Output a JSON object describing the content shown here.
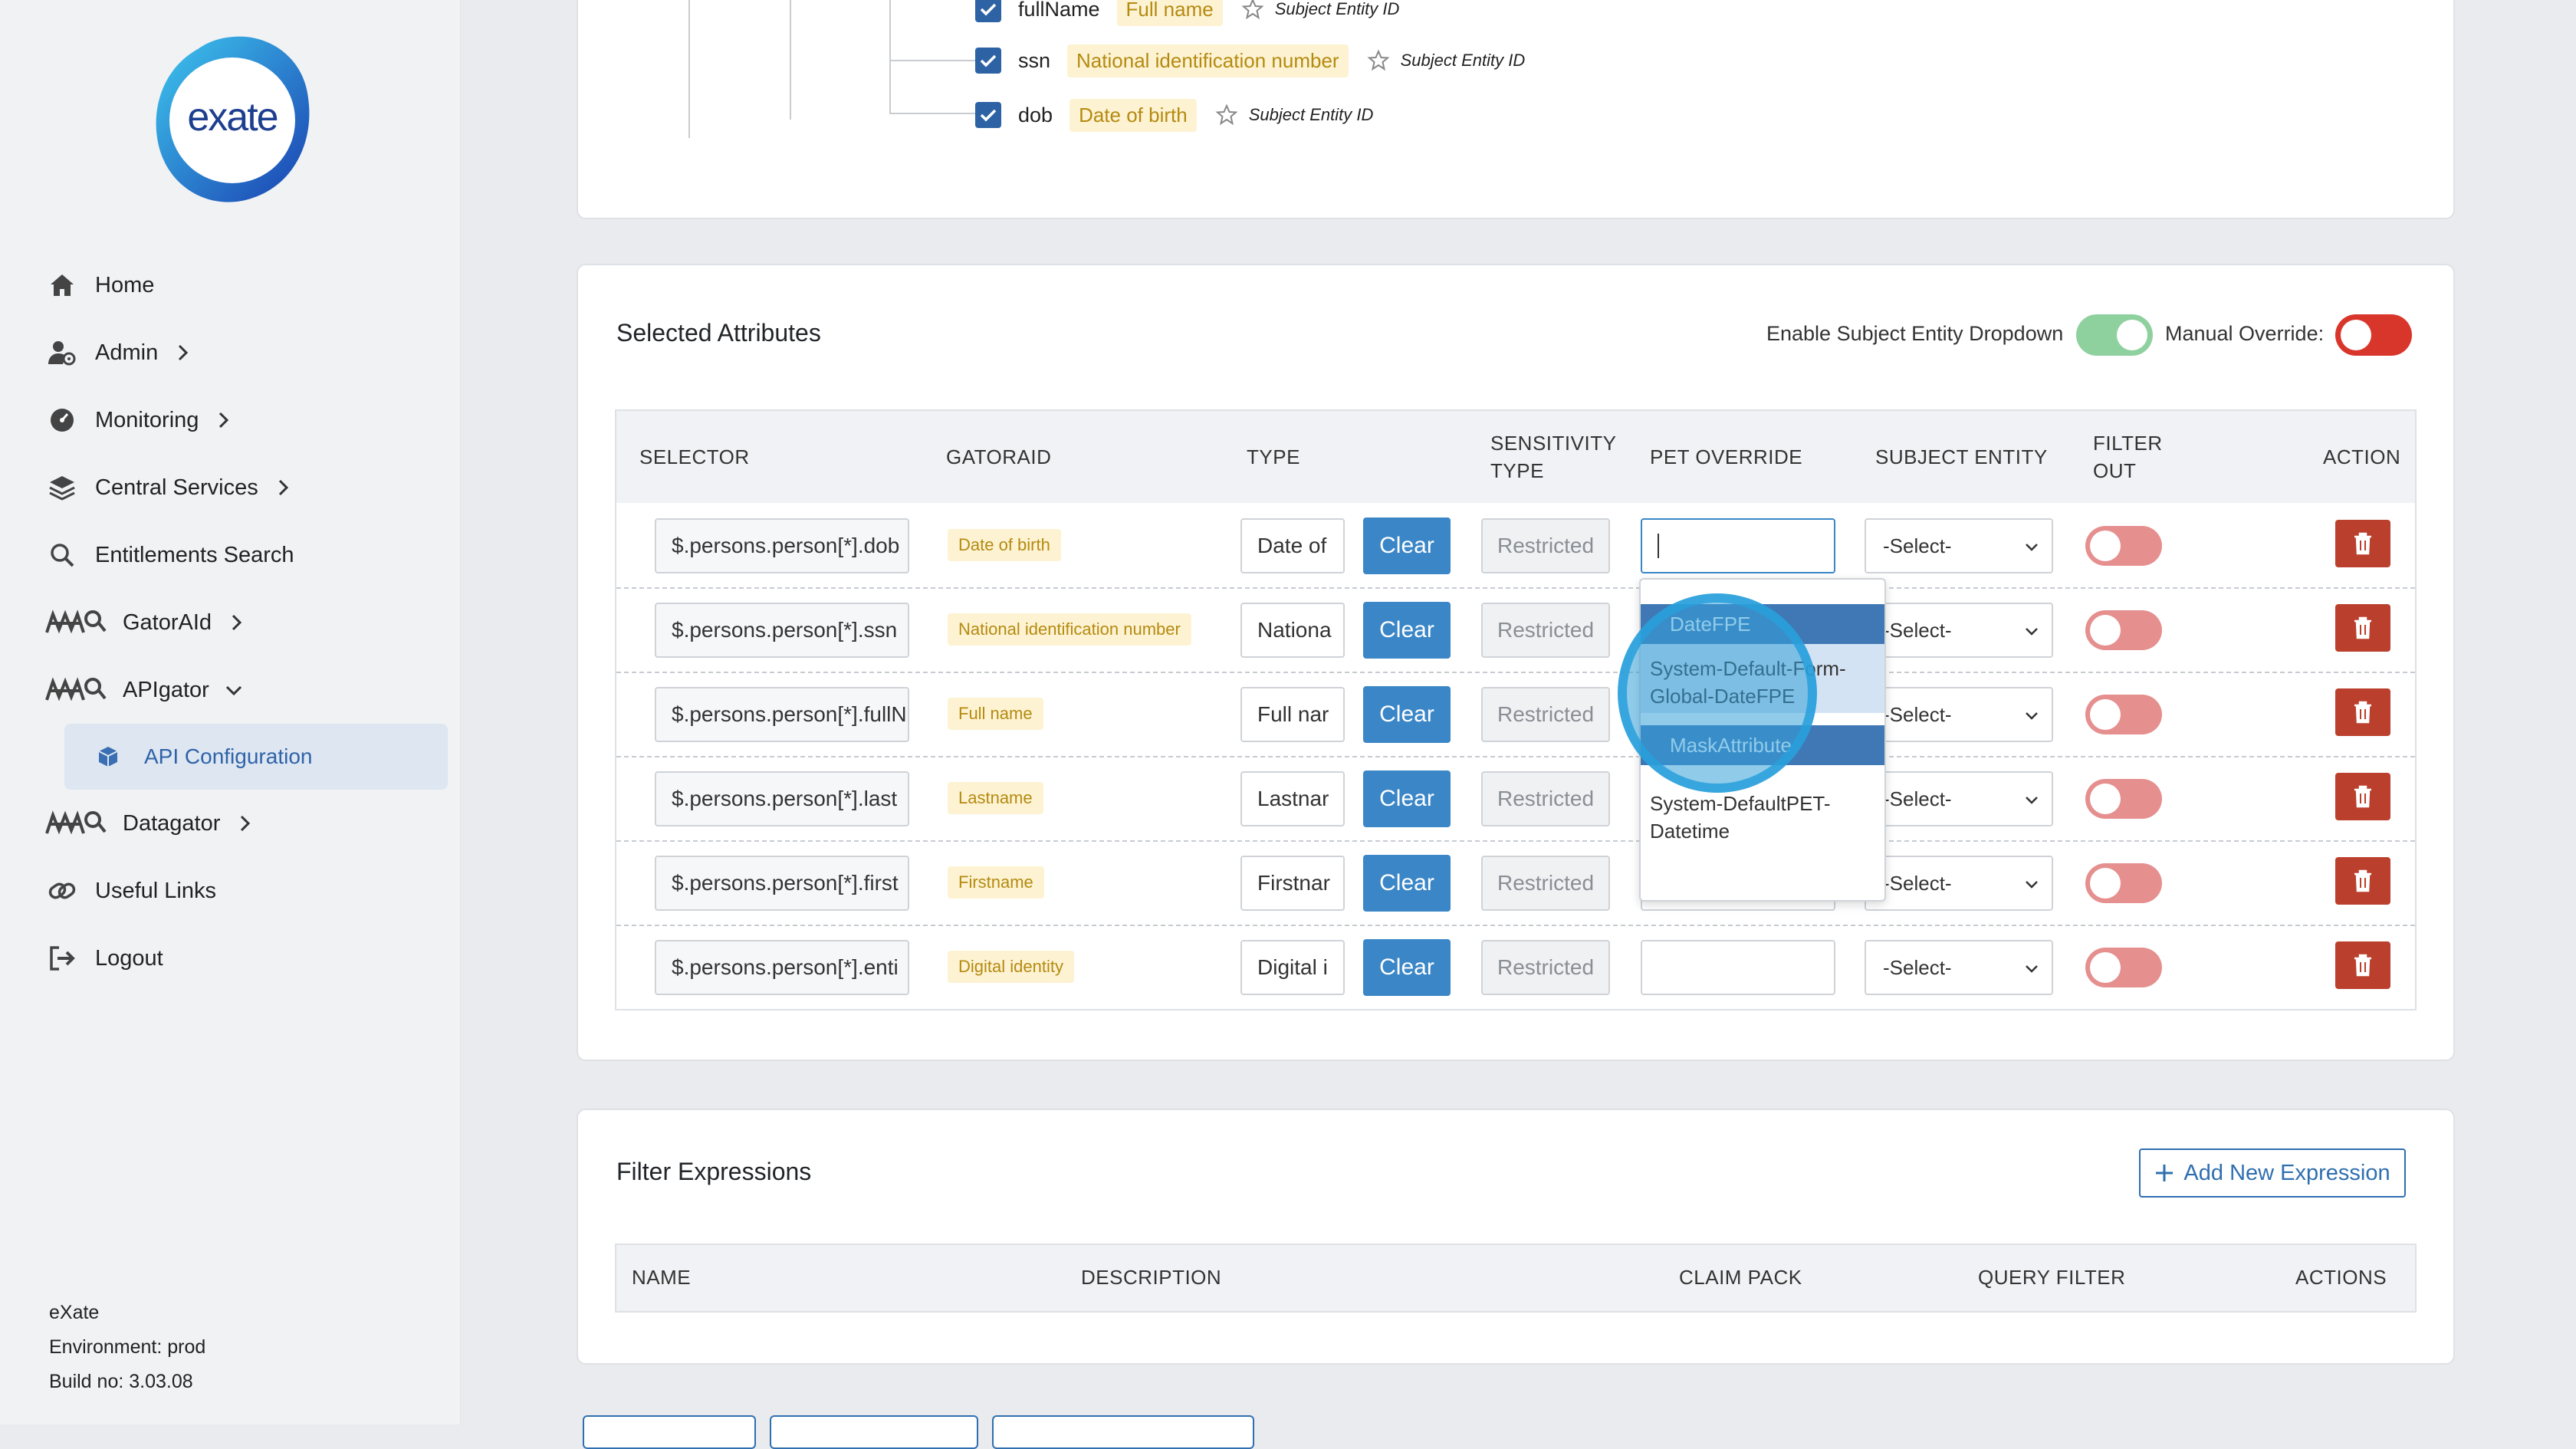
{
  "sidebar": {
    "logo_text": "exate",
    "nav": [
      {
        "label": "Home",
        "icon": "home-icon"
      },
      {
        "label": "Admin",
        "icon": "user-gear-icon"
      },
      {
        "label": "Monitoring",
        "icon": "gauge-icon"
      },
      {
        "label": "Central Services",
        "icon": "layers-icon"
      },
      {
        "label": "Entitlements Search",
        "icon": "search-icon"
      },
      {
        "label": "GatorAId",
        "icon": "gator-icon"
      },
      {
        "label": "APIgator",
        "icon": "gator-icon"
      },
      {
        "label": "API Configuration",
        "icon": "cube-icon"
      },
      {
        "label": "Datagator",
        "icon": "gator-icon"
      },
      {
        "label": "Useful Links",
        "icon": "link-icon"
      },
      {
        "label": "Logout",
        "icon": "logout-icon"
      }
    ],
    "footer": {
      "company": "eXate",
      "environment": "Environment: prod",
      "build": "Build no: 3.03.08"
    }
  },
  "tree": {
    "rows": [
      {
        "field": "fullName",
        "tag": "Full name",
        "subject": "Subject Entity ID"
      },
      {
        "field": "ssn",
        "tag": "National identification number",
        "subject": "Subject Entity ID"
      },
      {
        "field": "dob",
        "tag": "Date of birth",
        "subject": "Subject Entity ID"
      }
    ]
  },
  "selected": {
    "title": "Selected Attributes",
    "enable_label": "Enable Subject Entity Dropdown",
    "manual_label": "Manual Override:",
    "enable_on": true,
    "manual_on": true,
    "headers": {
      "selector": "SELECTOR",
      "gatoraid": "GATORAID",
      "type": "TYPE",
      "sensitivity": "SENSITIVITY TYPE",
      "pet": "PET OVERRIDE",
      "subject": "SUBJECT ENTITY",
      "filter": "FILTER OUT",
      "action": "ACTION"
    },
    "rows": [
      {
        "selector": "$.persons.person[*].dob",
        "gatoraid": "Date of birth",
        "type": "Date of",
        "clear": "Clear",
        "sensitivity": "Restricted",
        "pet": "",
        "subject": "-Select-"
      },
      {
        "selector": "$.persons.person[*].ssn",
        "gatoraid": "National identification number",
        "type": "Nationa",
        "clear": "Clear",
        "sensitivity": "Restricted",
        "pet": "",
        "subject": "-Select-"
      },
      {
        "selector": "$.persons.person[*].fullN",
        "gatoraid": "Full name",
        "type": "Full nar",
        "clear": "Clear",
        "sensitivity": "Restricted",
        "pet": "",
        "subject": "-Select-"
      },
      {
        "selector": "$.persons.person[*].last",
        "gatoraid": "Lastname",
        "type": "Lastnar",
        "clear": "Clear",
        "sensitivity": "Restricted",
        "pet": "",
        "subject": "-Select-"
      },
      {
        "selector": "$.persons.person[*].first",
        "gatoraid": "Firstname",
        "type": "Firstnar",
        "clear": "Clear",
        "sensitivity": "Restricted",
        "pet": "",
        "subject": "-Select-"
      },
      {
        "selector": "$.persons.person[*].enti",
        "gatoraid": "Digital identity",
        "type": "Digital i",
        "clear": "Clear",
        "sensitivity": "Restricted",
        "pet": "",
        "subject": "-Select-"
      }
    ],
    "dropdown": {
      "group1": "DateFPE",
      "opt1": "System-Default-Form-Global-DateFPE",
      "group2": "MaskAttribute",
      "opt2": "System-DefaultPET-Datetime"
    }
  },
  "filters": {
    "title": "Filter Expressions",
    "add_button": "Add New Expression",
    "headers": {
      "name": "NAME",
      "description": "DESCRIPTION",
      "claim_pack": "CLAIM PACK",
      "query_filter": "QUERY FILTER",
      "actions": "ACTIONS"
    }
  },
  "colors": {
    "primary": "#3a86c7",
    "delete": "#bb3f2d",
    "toggle_green": "#8fd19e",
    "toggle_red": "#d9362b",
    "tag_bg": "#fdf3d2",
    "tag_text": "#b58a11"
  }
}
